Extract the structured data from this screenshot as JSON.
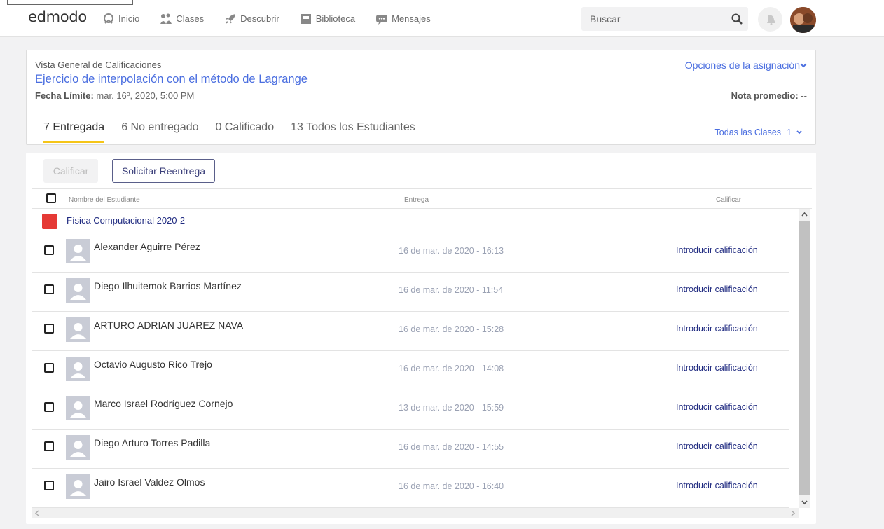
{
  "header": {
    "logo": "edmodo",
    "nav": [
      {
        "label": "Inicio",
        "icon": "home-icon"
      },
      {
        "label": "Clases",
        "icon": "classes-icon"
      },
      {
        "label": "Descubrir",
        "icon": "rocket-icon"
      },
      {
        "label": "Biblioteca",
        "icon": "library-icon"
      },
      {
        "label": "Mensajes",
        "icon": "messages-icon"
      }
    ],
    "search_placeholder": "Buscar"
  },
  "assignment": {
    "overview_label": "Vista General de Calificaciones",
    "title": "Ejercicio de interpolación con el método de Lagrange",
    "due_label": "Fecha Límite:",
    "due_value": "mar. 16º, 2020, 5:00 PM",
    "options_label": "Opciones de la asignación",
    "avg_label": "Nota promedio:",
    "avg_value": "--",
    "tabs": [
      {
        "label": "7 Entregada",
        "active": true
      },
      {
        "label": "6 No entregado",
        "active": false
      },
      {
        "label": "0 Calificado",
        "active": false
      },
      {
        "label": "13 Todos los Estudiantes",
        "active": false
      }
    ],
    "class_filter_label": "Todas las Clases",
    "class_filter_count": "1"
  },
  "toolbar": {
    "grade_label": "Calificar",
    "resubmit_label": "Solicitar Reentrega"
  },
  "table": {
    "col_name": "Nombre del Estudiante",
    "col_submission": "Entrega",
    "col_grade": "Calificar",
    "group_name": "Física Computacional 2020-2",
    "group_color": "#e53935",
    "rows": [
      {
        "name": "Alexander Aguirre Pérez",
        "date": "16 de mar. de 2020 - 16:13",
        "action": "Introducir calificación"
      },
      {
        "name": "Diego Ilhuitemok Barrios Martínez",
        "date": "16 de mar. de 2020 - 11:54",
        "action": "Introducir calificación"
      },
      {
        "name": "ARTURO ADRIAN JUAREZ NAVA",
        "date": "16 de mar. de 2020 - 15:28",
        "action": "Introducir calificación"
      },
      {
        "name": "Octavio Augusto Rico Trejo",
        "date": "16 de mar. de 2020 - 14:08",
        "action": "Introducir calificación"
      },
      {
        "name": "Marco Israel Rodríguez Cornejo",
        "date": "13 de mar. de 2020 - 15:59",
        "action": "Introducir calificación"
      },
      {
        "name": "Diego Arturo Torres Padilla",
        "date": "16 de mar. de 2020 - 14:55",
        "action": "Introducir calificación"
      },
      {
        "name": "Jairo Israel Valdez Olmos",
        "date": "16 de mar. de 2020 - 16:40",
        "action": "Introducir calificación"
      }
    ]
  }
}
